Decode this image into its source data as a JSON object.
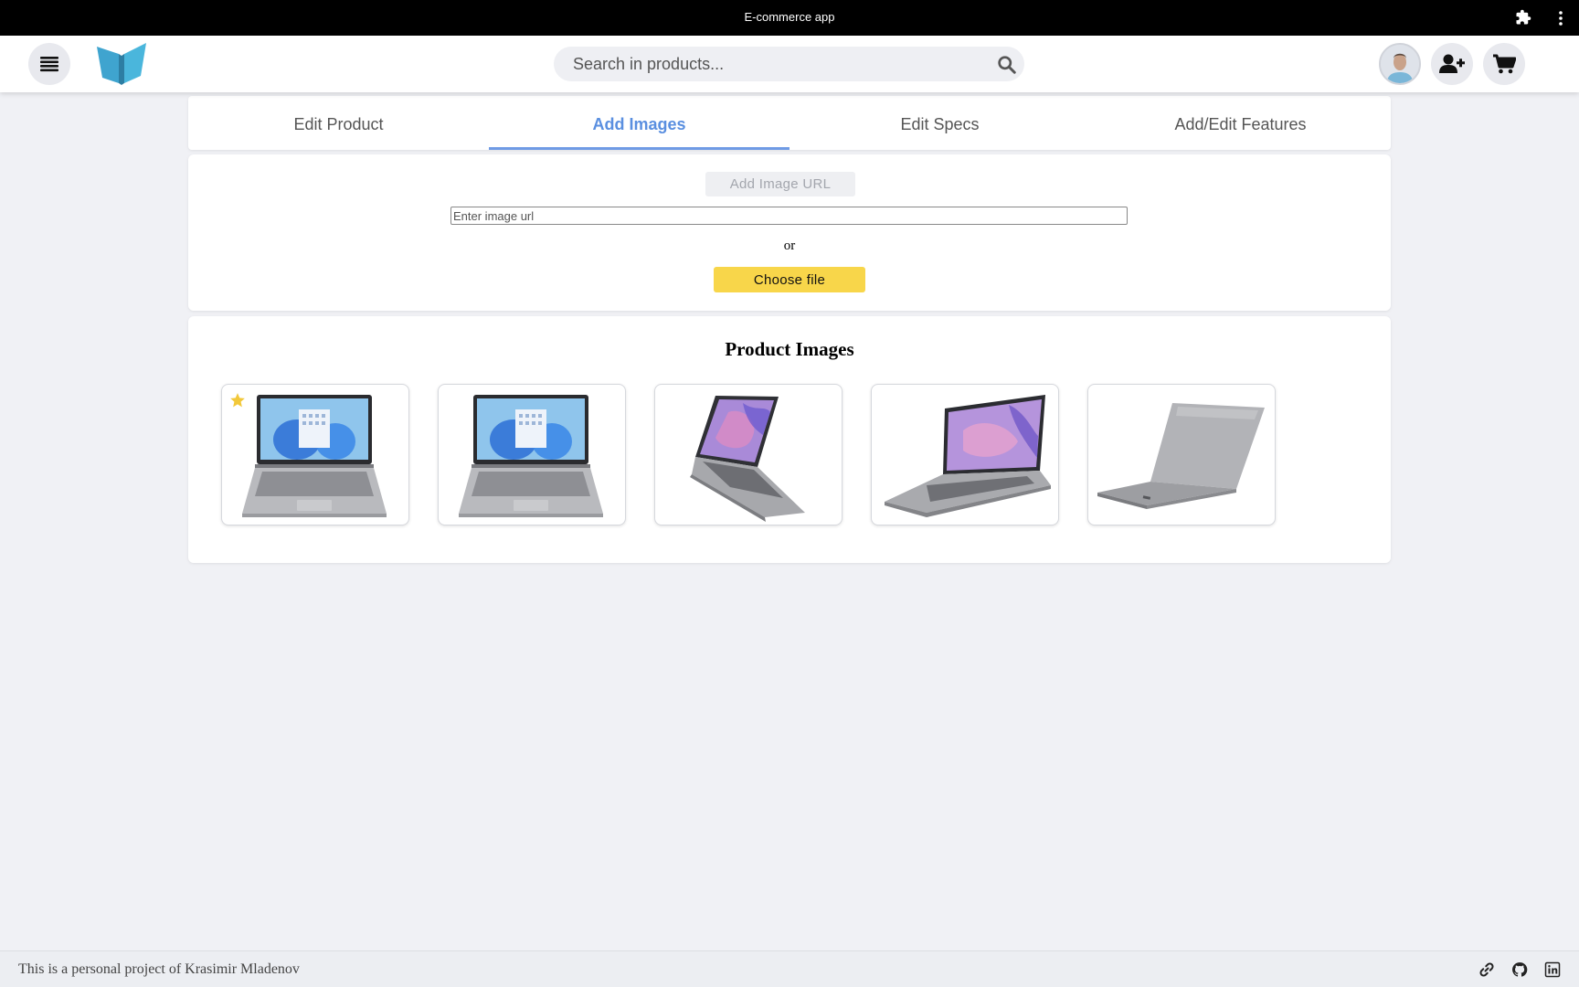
{
  "window": {
    "title": "E-commerce app",
    "extension_icon": "puzzle-icon",
    "menu_icon": "kebab-menu-icon"
  },
  "navbar": {
    "menu_icon": "hamburger-icon",
    "logo": "butterfly-logo",
    "search": {
      "placeholder": "Search in products...",
      "value": "",
      "icon": "search-icon"
    },
    "avatar": "user-avatar",
    "add_user_icon": "add-user-icon",
    "cart_icon": "cart-icon"
  },
  "tabs": [
    {
      "label": "Edit Product",
      "active": false
    },
    {
      "label": "Add Images",
      "active": true
    },
    {
      "label": "Edit Specs",
      "active": false
    },
    {
      "label": "Add/Edit Features",
      "active": false
    }
  ],
  "add_images": {
    "add_url_label": "Add Image URL",
    "url_placeholder": "Enter image url",
    "url_value": "",
    "or_text": "or",
    "choose_file_label": "Choose file"
  },
  "product_images": {
    "title": "Product Images",
    "images": [
      {
        "kind": "laptop-front",
        "main": true
      },
      {
        "kind": "laptop-front",
        "main": false
      },
      {
        "kind": "laptop-angled-purple",
        "main": false
      },
      {
        "kind": "laptop-side-purple",
        "main": false
      },
      {
        "kind": "laptop-closed",
        "main": false
      }
    ],
    "main_marker_icon": "star-icon"
  },
  "footer": {
    "credit": "This is a personal project of Krasimir Mladenov",
    "icons": [
      "link-icon",
      "github-icon",
      "linkedin-icon"
    ]
  },
  "colors": {
    "accent": "#5a8fe0",
    "choose_file": "#f8d64a",
    "star": "#f2c83a",
    "logo": "#4ab0d6"
  }
}
